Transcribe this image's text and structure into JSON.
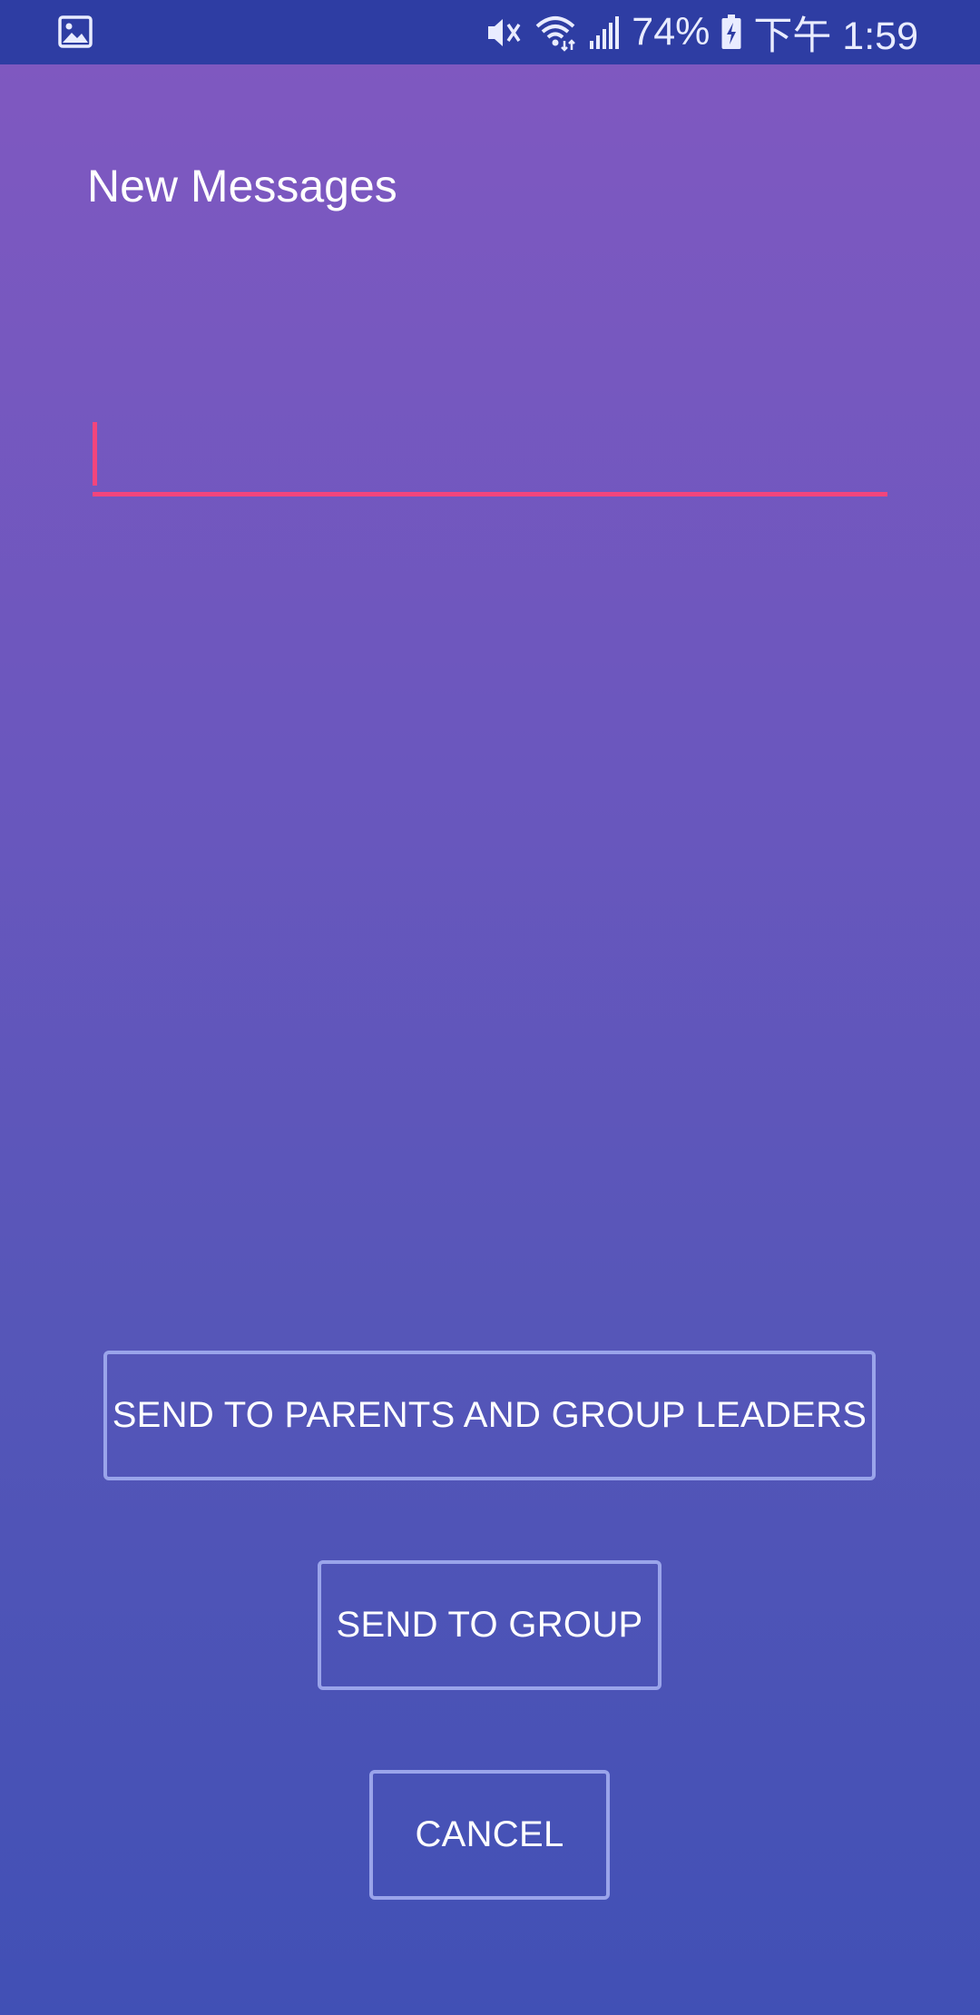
{
  "status_bar": {
    "battery_percent": "74%",
    "time": "下午 1:59",
    "icons": [
      "gallery-icon",
      "mute-icon",
      "wifi-icon",
      "signal-icon",
      "battery-charging-icon"
    ]
  },
  "screen": {
    "title": "New Messages",
    "message_input": {
      "value": "",
      "placeholder": "",
      "accent_color": "#f3457c"
    },
    "buttons": {
      "send_parents_leaders": "SEND TO PARENTS AND GROUP LEADERS",
      "send_group": "SEND TO GROUP",
      "cancel": "CANCEL"
    }
  },
  "colors": {
    "status_bar": "#2e3da3",
    "gradient_top": "#7f58c0",
    "gradient_bottom": "#4150b5",
    "button_border": "#9aa4ea",
    "text": "#ffffff"
  }
}
